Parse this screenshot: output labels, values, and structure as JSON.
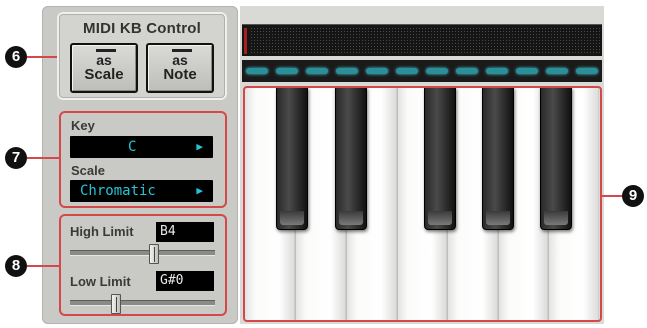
{
  "callouts": {
    "n6": "6",
    "n7": "7",
    "n8": "8",
    "n9": "9"
  },
  "midi_kb_control": {
    "title": "MIDI KB Control",
    "scale_button": {
      "line1": "as",
      "line2": "Scale"
    },
    "note_button": {
      "line1": "as",
      "line2": "Note"
    }
  },
  "key_scale": {
    "key_label": "Key",
    "key_value": "C",
    "scale_label": "Scale",
    "scale_value": "Chromatic",
    "arrow": "▶"
  },
  "limits": {
    "high_label": "High Limit",
    "high_value": "B4",
    "low_label": "Low Limit",
    "low_value": "G#0"
  },
  "colors": {
    "lcd_text": "#23c6d6",
    "callout_line": "#d5484a",
    "panel": "#c9c9c6"
  },
  "icons": {
    "dropdown": "play-arrow-icon"
  }
}
